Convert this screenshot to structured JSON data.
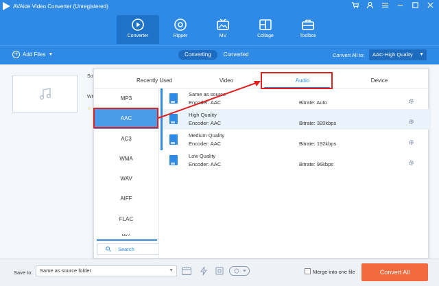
{
  "app": {
    "title": "AVAide Video Converter (Unregistered)",
    "accent": "#2f8ae6",
    "window_controls": [
      "cart-icon",
      "user-icon",
      "menu-icon",
      "minimize-icon",
      "maximize-icon",
      "close-icon"
    ]
  },
  "nav": {
    "converter": "Converter",
    "ripper": "Ripper",
    "mv": "MV",
    "collage": "Collage",
    "toolbox": "Toolbox"
  },
  "toolbar": {
    "add_files": "Add Files",
    "tab_converting": "Converting",
    "tab_converted": "Converted",
    "convert_all_label": "Convert All to:",
    "convert_all_value": "AAC-High Quality"
  },
  "file_row": {
    "name_partial": "So",
    "format_partial": "WM"
  },
  "dropdown": {
    "tabs": {
      "recent": "Recently Used",
      "video": "Video",
      "audio": "Audio",
      "device": "Device"
    },
    "formats": [
      "MP3",
      "AAC",
      "AC3",
      "WMA",
      "WAV",
      "AIFF",
      "FLAC",
      "MKA"
    ],
    "selected_format": "AAC",
    "search_placeholder": "Search",
    "presets": [
      {
        "name": "Same as source",
        "encoder": "Encoder: AAC",
        "bitrate": "Bitrate: Auto"
      },
      {
        "name": "High Quality",
        "encoder": "Encoder: AAC",
        "bitrate": "Bitrate: 320kbps"
      },
      {
        "name": "Medium Quality",
        "encoder": "Encoder: AAC",
        "bitrate": "Bitrate: 192kbps"
      },
      {
        "name": "Low Quality",
        "encoder": "Encoder: AAC",
        "bitrate": "Bitrate: 96kbps"
      }
    ]
  },
  "footer": {
    "save_to_label": "Save to:",
    "save_to_value": "Same as source folder",
    "merge_label": "Merge into one file",
    "convert_all_button": "Convert All",
    "convert_color": "#f26a3d"
  },
  "annotation": {
    "highlight_color": "#e0201f"
  }
}
